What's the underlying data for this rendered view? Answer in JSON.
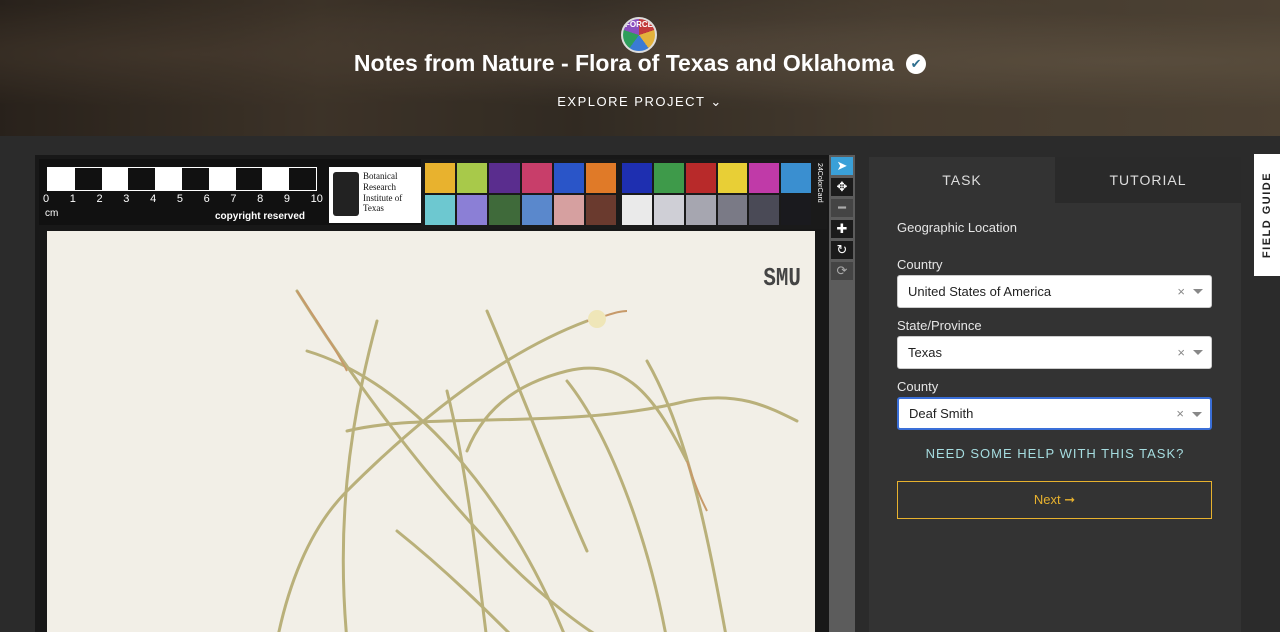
{
  "header": {
    "avatar_text": "FORCE",
    "project_title": "Notes from Nature - Flora of Texas and Oklahoma",
    "verified_icon": "check-circle-icon",
    "explore_label": "EXPLORE PROJECT ⌄"
  },
  "specimen": {
    "ruler_numbers": [
      "0",
      "1",
      "2",
      "3",
      "4",
      "5",
      "6",
      "7",
      "8",
      "9",
      "10"
    ],
    "ruler_unit": "cm",
    "copyright": "copyright reserved",
    "institute_lines": [
      "Botanical",
      "Research",
      "Institute of",
      "Texas"
    ],
    "colorcard_label": "24ColorCard",
    "herbarium_code": "SMU",
    "colors_a": [
      "#e8b22e",
      "#a8c94a",
      "#5a2d8e",
      "#c83e6a",
      "#2a55c8",
      "#e07a28",
      "#6dc8d0",
      "#8b7fd6",
      "#3f6a3a",
      "#5a88cc",
      "#d6a0a0",
      "#6a3a2e"
    ],
    "colors_b": [
      "#1e2fb0",
      "#3e9a4a",
      "#b82a2a",
      "#e8cf36",
      "#c03aa8",
      "#3a8fd0",
      "#eaeaea",
      "#cfcfd6",
      "#a6a6b0",
      "#7a7a86",
      "#4a4a56",
      "#1a1a1e"
    ]
  },
  "toolbar": {
    "tools": [
      {
        "name": "select-tool",
        "glyph": "➤",
        "state": "active"
      },
      {
        "name": "move-tool",
        "glyph": "✥",
        "state": "normal"
      },
      {
        "name": "zoom-out-tool",
        "glyph": "━",
        "state": "dim"
      },
      {
        "name": "zoom-in-tool",
        "glyph": "✚",
        "state": "normal"
      },
      {
        "name": "rotate-tool",
        "glyph": "↻",
        "state": "normal"
      },
      {
        "name": "reset-tool",
        "glyph": "⟳",
        "state": "dim"
      }
    ]
  },
  "panel": {
    "tabs": [
      "TASK",
      "TUTORIAL"
    ],
    "question": "Geographic Location",
    "fields": [
      {
        "label": "Country",
        "value": "United States of America"
      },
      {
        "label": "State/Province",
        "value": "Texas"
      },
      {
        "label": "County",
        "value": "Deaf Smith"
      }
    ],
    "clear_glyph": "×",
    "help_link": "NEED SOME HELP WITH THIS TASK?",
    "next_label": "Next ➞"
  },
  "field_guide": {
    "label": "FIELD GUIDE"
  }
}
